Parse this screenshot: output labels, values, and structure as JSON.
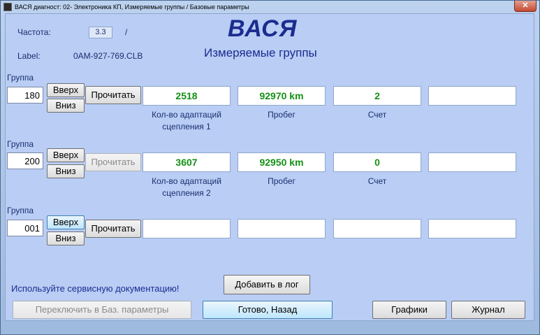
{
  "window": {
    "title": "ВАСЯ диагност: 02- Электроника КП,  Измеряемые группы / Базовые параметры",
    "close_symbol": "✕"
  },
  "header": {
    "freq_label": "Частота:",
    "freq_value": "3.3",
    "freq_sep": "/",
    "label_label": "Label:",
    "label_value": "0AM-927-769.CLB",
    "brand": "ВАСЯ",
    "subtitle": "Измеряемые группы"
  },
  "groups": [
    {
      "label": "Группа",
      "number": "180",
      "up": "Вверх",
      "down": "Вниз",
      "read": "Прочитать",
      "fields": [
        {
          "value": "2518",
          "caption_1": "Кол-во адаптаций",
          "caption_2": "сцепления 1"
        },
        {
          "value": "92970 km",
          "caption_1": "Пробег",
          "caption_2": ""
        },
        {
          "value": "2",
          "caption_1": "Счет",
          "caption_2": ""
        },
        {
          "value": "",
          "caption_1": "",
          "caption_2": ""
        }
      ]
    },
    {
      "label": "Группа",
      "number": "200",
      "up": "Вверх",
      "down": "Вниз",
      "read": "Прочитать",
      "fields": [
        {
          "value": "3607",
          "caption_1": "Кол-во адаптаций",
          "caption_2": "сцепления 2"
        },
        {
          "value": "92950 km",
          "caption_1": "Пробег",
          "caption_2": ""
        },
        {
          "value": "0",
          "caption_1": "Счет",
          "caption_2": ""
        },
        {
          "value": "",
          "caption_1": "",
          "caption_2": ""
        }
      ]
    },
    {
      "label": "Группа",
      "number": "001",
      "up": "Вверх",
      "down": "Вниз",
      "read": "Прочитать",
      "fields": [
        {
          "value": "",
          "caption_1": "",
          "caption_2": ""
        },
        {
          "value": "",
          "caption_1": "",
          "caption_2": ""
        },
        {
          "value": "",
          "caption_1": "",
          "caption_2": ""
        },
        {
          "value": "",
          "caption_1": "",
          "caption_2": ""
        }
      ]
    }
  ],
  "footer": {
    "notice": "Используйте сервисную документацию!",
    "add_log": "Добавить в лог",
    "switch_basic": "Переключить в Баз. параметры",
    "done": "Готово, Назад",
    "graphs": "Графики",
    "journal": "Журнал"
  },
  "colors": {
    "value_green": "#159016",
    "label_blue": "#1b2c8f"
  }
}
